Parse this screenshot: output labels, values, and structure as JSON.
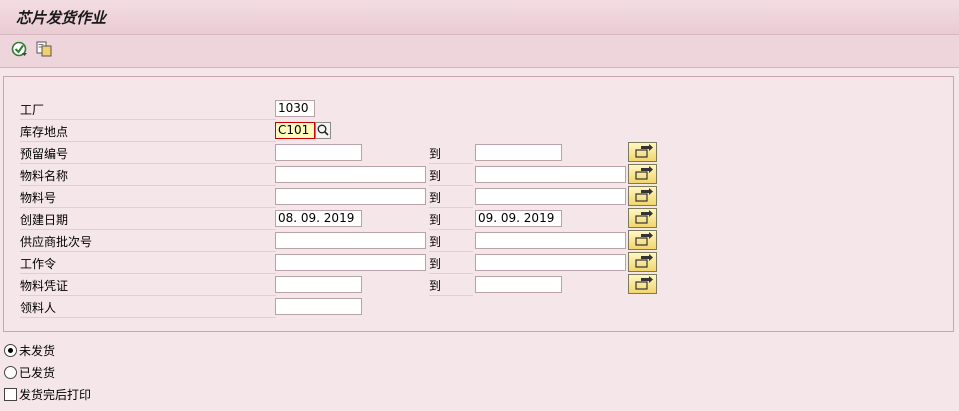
{
  "title": "芯片发货作业",
  "toolbar": {
    "execute_icon": "execute-icon",
    "variant_icon": "get-variant-icon"
  },
  "fields": {
    "plant": {
      "label": "工厂",
      "value": "1030"
    },
    "storage_location": {
      "label": "库存地点",
      "value": "C101"
    },
    "reservation_no": {
      "label": "预留编号",
      "from": "",
      "to_label": "到",
      "to": ""
    },
    "material_name": {
      "label": "物料名称",
      "from": "",
      "to_label": "到",
      "to": ""
    },
    "material_no": {
      "label": "物料号",
      "from": "",
      "to_label": "到",
      "to": ""
    },
    "created_date": {
      "label": "创建日期",
      "from": "08. 09. 2019",
      "to_label": "到",
      "to": "09. 09. 2019"
    },
    "supplier_batch": {
      "label": "供应商批次号",
      "from": "",
      "to_label": "到",
      "to": ""
    },
    "work_order": {
      "label": "工作令",
      "from": "",
      "to_label": "到",
      "to": ""
    },
    "material_doc": {
      "label": "物料凭证",
      "from": "",
      "to_label": "到",
      "to": ""
    },
    "receiver": {
      "label": "领料人",
      "value": ""
    }
  },
  "options": {
    "not_shipped": {
      "label": "未发货",
      "selected": true
    },
    "shipped": {
      "label": "已发货",
      "selected": false
    },
    "print_after": {
      "label": "发货完后打印",
      "checked": false
    }
  }
}
